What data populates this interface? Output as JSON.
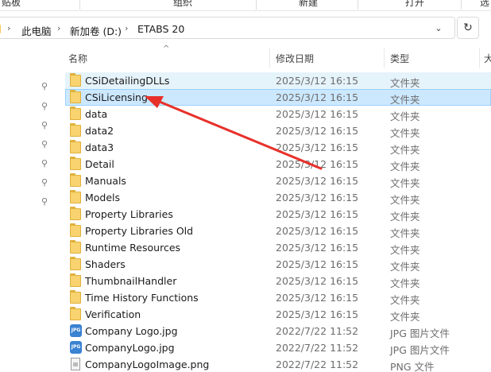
{
  "ribbon": {
    "items": [
      "贴板",
      "组织",
      "新建",
      "打开",
      "选"
    ]
  },
  "address": {
    "crumbs": [
      "此电脑",
      "新加卷 (D:)",
      "ETABS 20"
    ],
    "dropdown_icon": "chevron-down-icon",
    "refresh_icon": "refresh-icon"
  },
  "columns": {
    "name": "名称",
    "date": "修改日期",
    "type": "类型",
    "size": "大"
  },
  "files": [
    {
      "name": "CSiDetailingDLLs",
      "date": "2025/3/12 16:15",
      "type": "文件夹",
      "kind": "folder",
      "state": "hover"
    },
    {
      "name": "CSiLicensing",
      "date": "2025/3/12 16:15",
      "type": "文件夹",
      "kind": "folder",
      "state": "selected"
    },
    {
      "name": "data",
      "date": "2025/3/12 16:15",
      "type": "文件夹",
      "kind": "folder"
    },
    {
      "name": "data2",
      "date": "2025/3/12 16:15",
      "type": "文件夹",
      "kind": "folder"
    },
    {
      "name": "data3",
      "date": "2025/3/12 16:15",
      "type": "文件夹",
      "kind": "folder"
    },
    {
      "name": "Detail",
      "date": "2025/3/12 16:15",
      "type": "文件夹",
      "kind": "folder"
    },
    {
      "name": "Manuals",
      "date": "2025/3/12 16:15",
      "type": "文件夹",
      "kind": "folder"
    },
    {
      "name": "Models",
      "date": "2025/3/12 16:15",
      "type": "文件夹",
      "kind": "folder"
    },
    {
      "name": "Property Libraries",
      "date": "2025/3/12 16:15",
      "type": "文件夹",
      "kind": "folder"
    },
    {
      "name": "Property Libraries Old",
      "date": "2025/3/12 16:15",
      "type": "文件夹",
      "kind": "folder"
    },
    {
      "name": "Runtime Resources",
      "date": "2025/3/12 16:15",
      "type": "文件夹",
      "kind": "folder"
    },
    {
      "name": "Shaders",
      "date": "2025/3/12 16:15",
      "type": "文件夹",
      "kind": "folder"
    },
    {
      "name": "ThumbnailHandler",
      "date": "2025/3/12 16:15",
      "type": "文件夹",
      "kind": "folder"
    },
    {
      "name": "Time History Functions",
      "date": "2025/3/12 16:15",
      "type": "文件夹",
      "kind": "folder"
    },
    {
      "name": "Verification",
      "date": "2025/3/12 16:15",
      "type": "文件夹",
      "kind": "folder"
    },
    {
      "name": "Company Logo.jpg",
      "date": "2022/7/22 11:52",
      "type": "JPG 图片文件",
      "kind": "jpg"
    },
    {
      "name": "CompanyLogo.jpg",
      "date": "2022/7/22 11:52",
      "type": "JPG 图片文件",
      "kind": "jpg"
    },
    {
      "name": "CompanyLogoImage.png",
      "date": "2022/7/22 11:52",
      "type": "PNG 文件",
      "kind": "png"
    }
  ],
  "jpg_icon_text": "JPG",
  "pins": {
    "count": 7,
    "icon": "pin-icon"
  },
  "colors": {
    "selected_bg": "#cce8ff",
    "hover_bg": "#e5f3fb",
    "folder": "#f8d36f",
    "annotation_arrow": "#e8302a"
  }
}
